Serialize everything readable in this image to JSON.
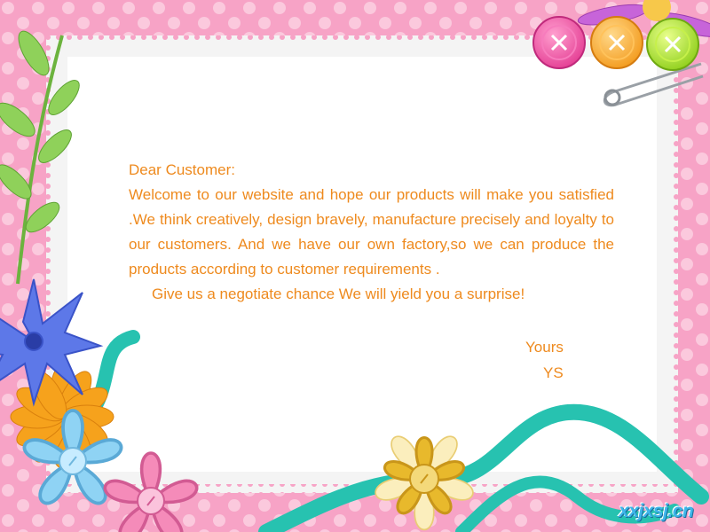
{
  "letter": {
    "greeting": "Dear Customer:",
    "body": "Welcome to our website and hope our products will make you satisfied .We think creatively, design bravely, manufacture precisely and loyalty to our customers. And we have our own factory,so we can produce the products according to customer requirements .",
    "closing_line": "Give us a negotiate chance We will yield you a surprise!",
    "signoff": "Yours",
    "signature": "YS"
  },
  "watermark": "xxjxsj.cn",
  "colors": {
    "text": "#ee8a1e",
    "pink_background": "#f7a3c6",
    "paper": "#ffffff",
    "ribbon": "#27c2b0",
    "watermark": "#3fb6ea"
  },
  "decorations": {
    "buttons": [
      "pink-button",
      "orange-button",
      "green-button"
    ],
    "flowers": [
      "blue-cornflower",
      "orange-daisy",
      "light-blue-flower",
      "pink-flower",
      "yellow-flower"
    ],
    "other": [
      "safety-pin",
      "purple-flower",
      "green-leaf-stem",
      "teal-ribbon"
    ]
  }
}
